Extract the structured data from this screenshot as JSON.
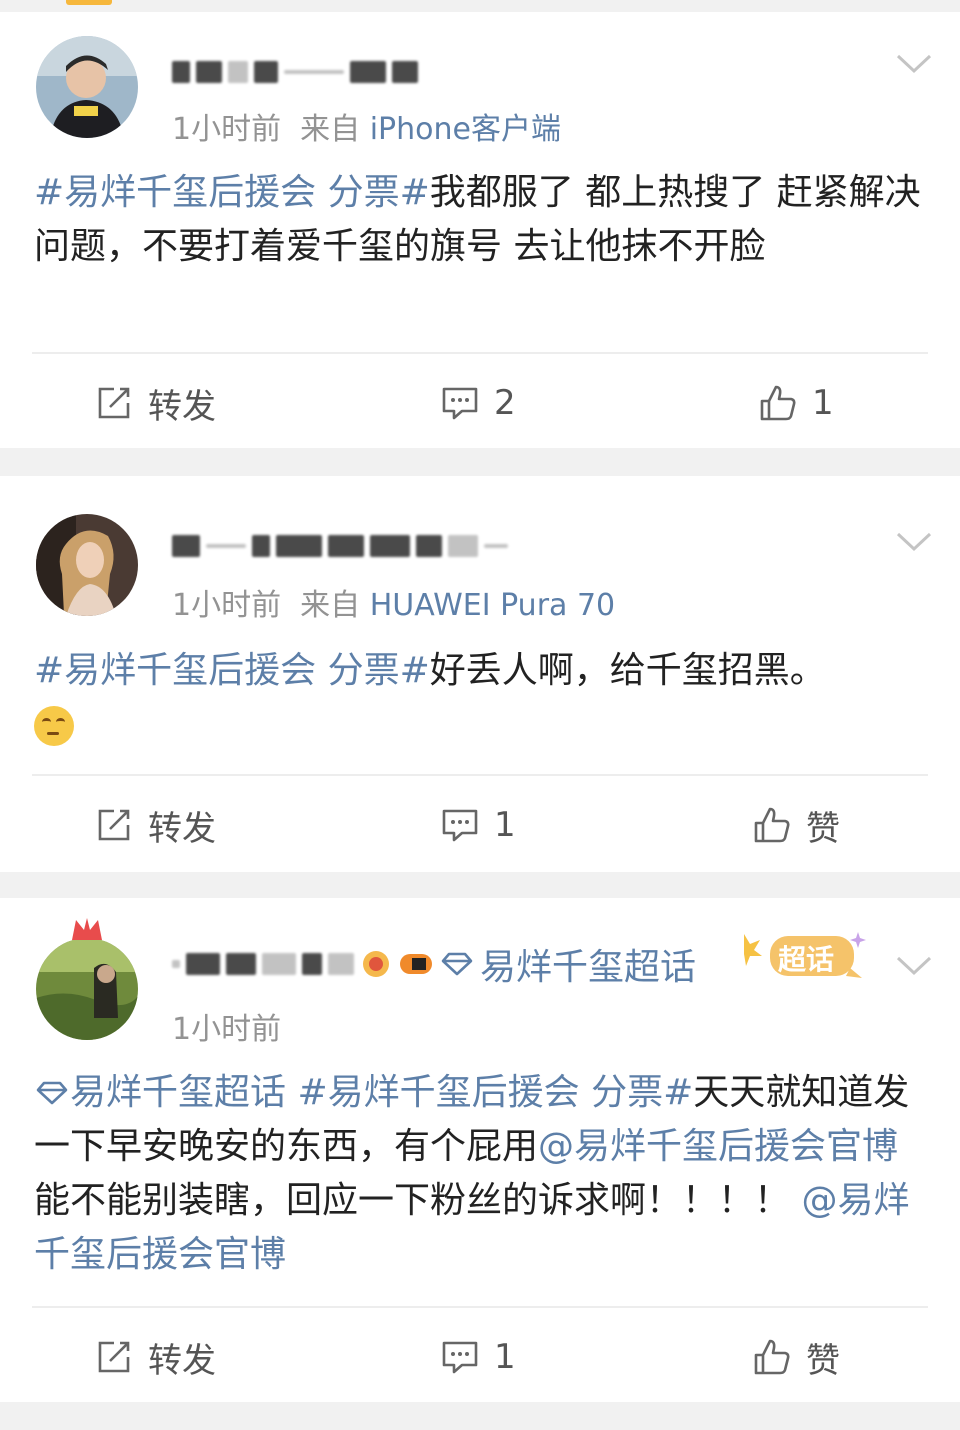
{
  "posts": [
    {
      "time": "1小时前",
      "from_label": "来自",
      "source": "iPhone客户端",
      "text_tag": "#易烊千玺后援会 分票#",
      "text_body": "我都服了 都上热搜了 赶紧解决问题，不要打着爱千玺的旗号 去让他抹不开脸",
      "repost_label": "转发",
      "comment_count": "2",
      "like_label": "1"
    },
    {
      "time": "1小时前",
      "from_label": "来自",
      "source": "HUAWEI Pura 70",
      "text_tag": "#易烊千玺后援会 分票#",
      "text_body": "好丢人啊，给千玺招黑。",
      "emoji": "thinking-emoji",
      "repost_label": "转发",
      "comment_count": "1",
      "like_label": "赞"
    },
    {
      "time": "1小时前",
      "chaohua_name": "易烊千玺超话",
      "chaohua_badge": "超话",
      "text_chaohua": "易烊千玺超话",
      "text_tag": "#易烊千玺后援会 分票#",
      "text_body1": "天天就知道发一下早安晚安的东西，有个屁用",
      "mention1": "@易烊千玺后援会官博",
      "text_body2": " 能不能别装瞎，回应一下粉丝的诉求啊！！！！",
      "mention2": "@易烊千玺后援会官博",
      "repost_label": "转发",
      "comment_count": "1",
      "like_label": "赞"
    }
  ],
  "colors": {
    "link": "#5d7fa8",
    "meta": "#939393",
    "text": "#222222",
    "bg": "#f1f1f1"
  }
}
